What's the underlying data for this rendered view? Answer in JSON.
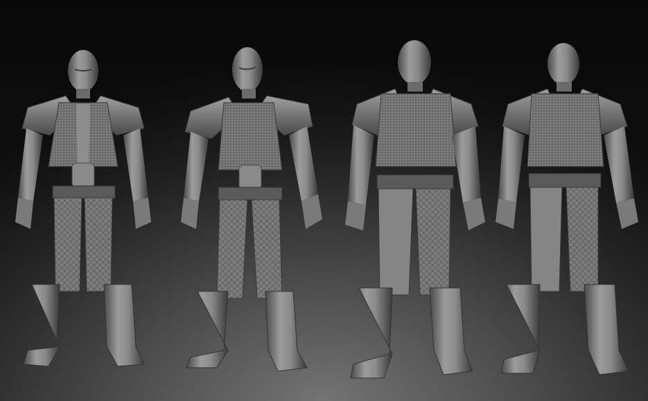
{
  "scene": {
    "background_top": "#121212",
    "background_bottom": "#6e6e6e",
    "material_base": "#8a8a8a",
    "material_shadow": "#3e3e3e",
    "material_highlight": "#b4b4b4"
  },
  "views": [
    {
      "id": "front"
    },
    {
      "id": "three-quarter-front"
    },
    {
      "id": "three-quarter-back"
    },
    {
      "id": "back"
    }
  ]
}
